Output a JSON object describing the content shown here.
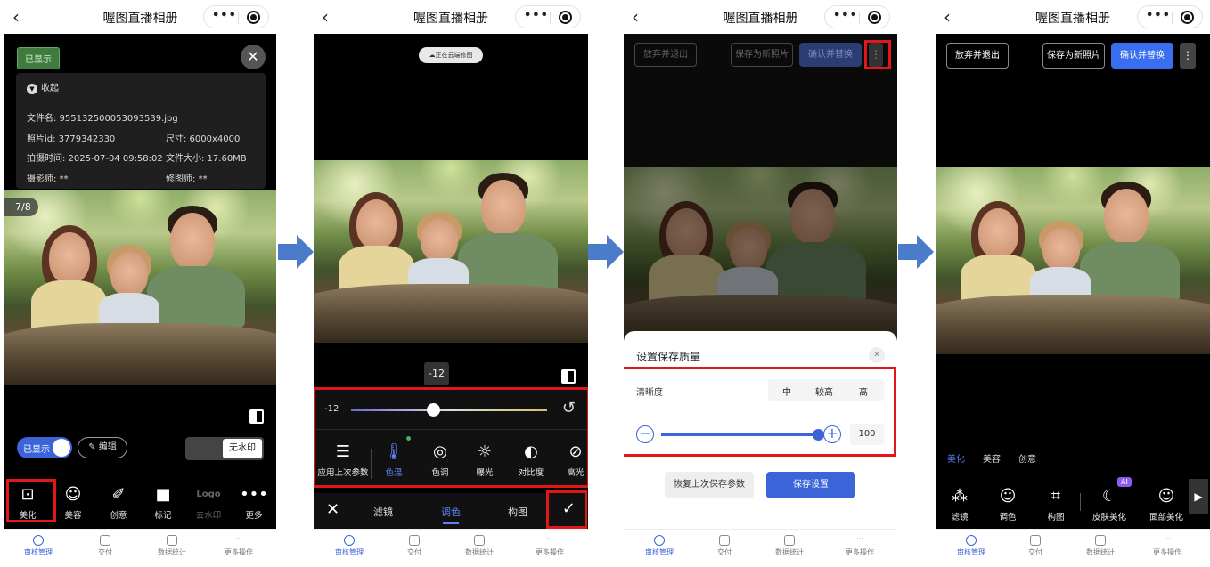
{
  "app_title": "喔图直播相册",
  "tabbar": [
    "审核管理",
    "交付",
    "数据统计",
    "更多操作"
  ],
  "screen1": {
    "shown_badge": "已显示",
    "collapse": "收起",
    "filename": "文件名: 955132500053093539.jpg",
    "photo_id": "照片id: 3779342330",
    "size": "尺寸: 6000x4000",
    "shot_time": "拍摄时间: 2025-07-04 09:58:02",
    "file_size": "文件大小: 17.60MB",
    "photographer": "摄影师: **",
    "retoucher": "修图师: **",
    "counter": "7/8",
    "toggle_label": "已显示",
    "edit_label": "编辑",
    "no_watermark": "无水印",
    "tools": [
      "美化",
      "美容",
      "创意",
      "标记",
      "去水印",
      "更多"
    ],
    "logo_text": "Logo"
  },
  "screen2": {
    "cloud_badge": "正在云端修图",
    "value_tip": "-12",
    "slider_value": "-12",
    "slider_fraction": 0.42,
    "tools": [
      "应用上次参数",
      "色温",
      "色调",
      "曝光",
      "对比度",
      "高光"
    ],
    "tabs": [
      "滤镜",
      "调色",
      "构图"
    ]
  },
  "screen3": {
    "btn_discard": "放弃并退出",
    "btn_save_new": "保存为新照片",
    "btn_confirm": "确认并替换",
    "sheet_title": "设置保存质量",
    "clarity_label": "清晰度",
    "clarity_options": [
      "中",
      "较高",
      "高"
    ],
    "quality_value": "100",
    "quality_fraction": 1.0,
    "btn_restore": "恢复上次保存参数",
    "btn_save_settings": "保存设置"
  },
  "screen4": {
    "btn_discard": "放弃并退出",
    "btn_save_new": "保存为新照片",
    "btn_confirm": "确认并替换",
    "categories": [
      "美化",
      "美容",
      "创意"
    ],
    "tools": [
      "滤镜",
      "调色",
      "构图",
      "皮肤美化",
      "面部美化"
    ],
    "ai_badge": "AI"
  },
  "colors": {
    "accent": "#3a64d8",
    "highlight": "#e01818",
    "arrow": "#4a7cc9"
  }
}
